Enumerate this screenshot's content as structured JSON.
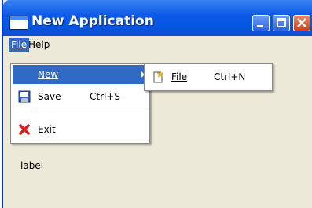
{
  "window": {
    "title": "New Application"
  },
  "menubar": {
    "items": [
      {
        "label": "File",
        "mnemonic": "F"
      },
      {
        "label": "Help",
        "mnemonic": "H"
      }
    ]
  },
  "file_menu": {
    "items": [
      {
        "label": "New",
        "mnemonic": "N",
        "shortcut": ""
      },
      {
        "label": "Save",
        "mnemonic": "S",
        "shortcut": "Ctrl+S"
      },
      {
        "label": "Exit",
        "mnemonic": "x",
        "shortcut": ""
      }
    ]
  },
  "new_submenu": {
    "items": [
      {
        "label": "File",
        "mnemonic": "F",
        "shortcut": "Ctrl+N"
      }
    ]
  },
  "content": {
    "label": "label"
  },
  "colors": {
    "highlight": "#316ac5",
    "titlebar": "#0a58e8",
    "close": "#c6431e"
  }
}
